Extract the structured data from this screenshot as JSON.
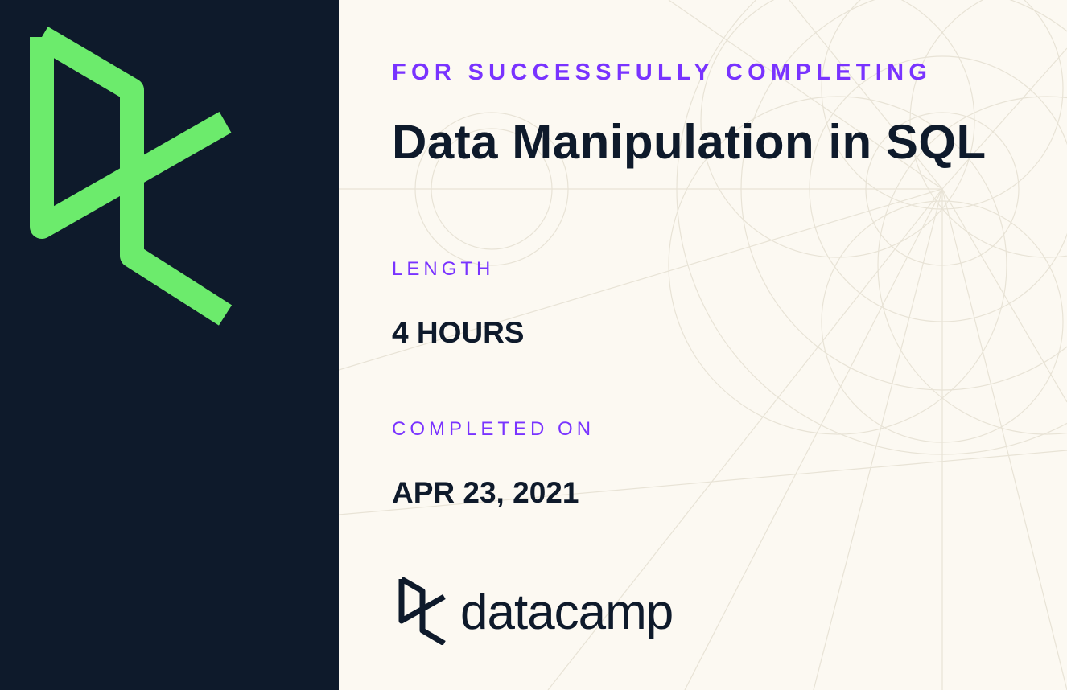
{
  "certificate": {
    "label": "FOR SUCCESSFULLY COMPLETING",
    "course_title": "Data Manipulation in SQL",
    "length_label": "LENGTH",
    "length_value": "4 HOURS",
    "completed_label": "COMPLETED ON",
    "completed_value": "APR 23, 2021"
  },
  "brand": {
    "wordmark": "datacamp",
    "logo_icon": "datacamp-dc-icon"
  },
  "colors": {
    "sidebar": "#0e1a2b",
    "accent_green": "#6ceb6c",
    "accent_purple": "#7933ff",
    "background": "#fcf9f2",
    "text": "#0e1a2b"
  }
}
